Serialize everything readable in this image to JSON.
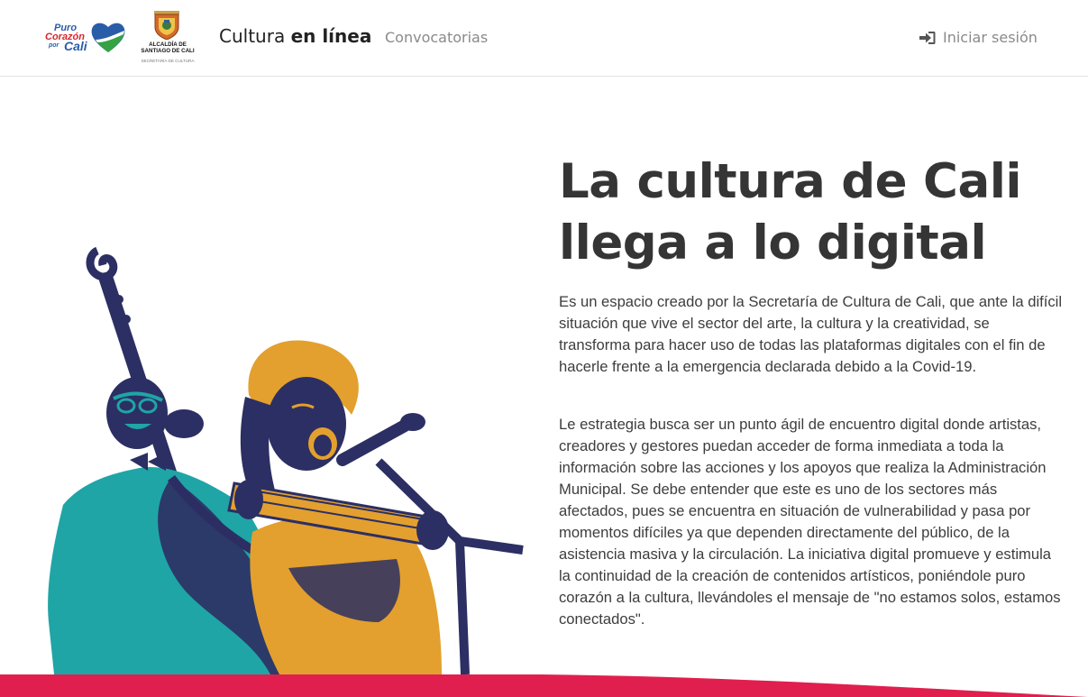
{
  "navbar": {
    "logo_puro": {
      "line1": "Puro",
      "line2": "Corazón",
      "line3": "por",
      "line4": "Cali"
    },
    "logo_alcaldia": {
      "line1": "ALCALDÍA DE",
      "line2": "SANTIAGO DE CALI",
      "line3": "SECRETARÍA DE CULTURA"
    },
    "brand": {
      "prefix": "Cultura ",
      "bold": "en línea"
    },
    "links": [
      {
        "label": "Convocatorias"
      }
    ],
    "login": {
      "label": "Iniciar sesión",
      "icon": "sign-in-icon"
    }
  },
  "hero": {
    "title_line1": "La cultura de Cali",
    "title_line2": "llega a lo digital",
    "paragraph1": "Es un espacio creado por la Secretaría de Cultura de Cali, que ante la difícil situación que vive el sector del arte, la cultura y la creatividad, se transforma para hacer uso de todas las plataformas digitales con el fin de hacerle frente a la emergencia declarada debido a la Covid-19.",
    "paragraph2": "Le estrategia busca ser un punto ágil de encuentro digital donde artistas, creadores y gestores puedan acceder de forma inmediata a toda la información sobre las acciones y los apoyos que realiza la Administración Municipal. Se debe entender que este es uno de los sectores más afectados, pues se encuentra en situación de vulnerabilidad y pasa por momentos difíciles ya que dependen directamente del público, de la asistencia masiva y la circulación. La iniciativa digital promueve y estimula la continuidad de la creación de contenidos artísticos, poniéndole puro corazón a la cultura, llevándoles el mensaje de \"no estamos solos, estamos conectados\"."
  },
  "colors": {
    "teal": "#1fa5a6",
    "mustard": "#e3a02e",
    "navy": "#2c2f63",
    "accent_band": "#e01f4e",
    "heading": "#353535"
  }
}
